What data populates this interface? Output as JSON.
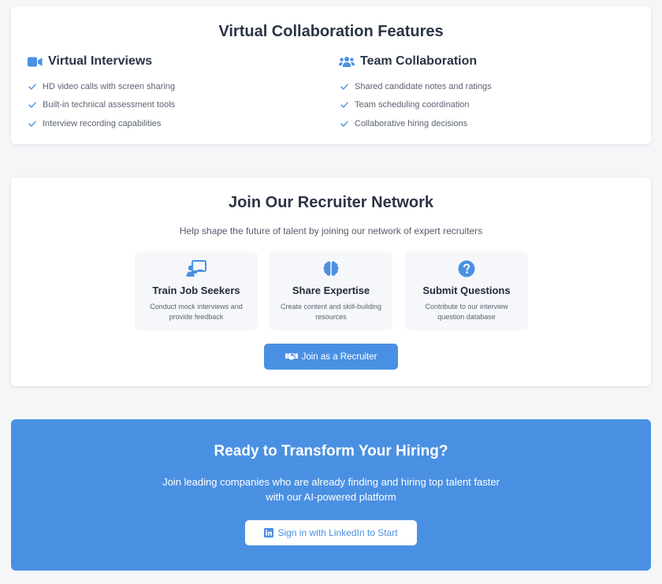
{
  "colors": {
    "accent": "#4a90e2",
    "heading": "#2b3445",
    "muted": "#5b6272"
  },
  "features": {
    "title": "Virtual Collaboration Features",
    "columns": [
      {
        "icon": "video-camera-icon",
        "heading": "Virtual Interviews",
        "items": [
          "HD video calls with screen sharing",
          "Built-in technical assessment tools",
          "Interview recording capabilities"
        ]
      },
      {
        "icon": "users-icon",
        "heading": "Team Collaboration",
        "items": [
          "Shared candidate notes and ratings",
          "Team scheduling coordination",
          "Collaborative hiring decisions"
        ]
      }
    ]
  },
  "recruiter": {
    "title": "Join Our Recruiter Network",
    "subtitle": "Help shape the future of talent by joining our network of expert recruiters",
    "tiles": [
      {
        "icon": "chalkboard-teacher-icon",
        "title": "Train Job Seekers",
        "description": "Conduct mock interviews and provide feedback"
      },
      {
        "icon": "brain-icon",
        "title": "Share Expertise",
        "description": "Create content and skill-building resources"
      },
      {
        "icon": "question-circle-icon",
        "title": "Submit Questions",
        "description": "Contribute to our interview question database"
      }
    ],
    "button": {
      "icon": "handshake-icon",
      "label": "Join as a Recruiter"
    }
  },
  "cta": {
    "title": "Ready to Transform Your Hiring?",
    "text": "Join leading companies who are already finding and hiring top talent faster with our AI-powered platform",
    "button": {
      "icon": "linkedin-icon",
      "label": "Sign in with LinkedIn to Start"
    }
  }
}
